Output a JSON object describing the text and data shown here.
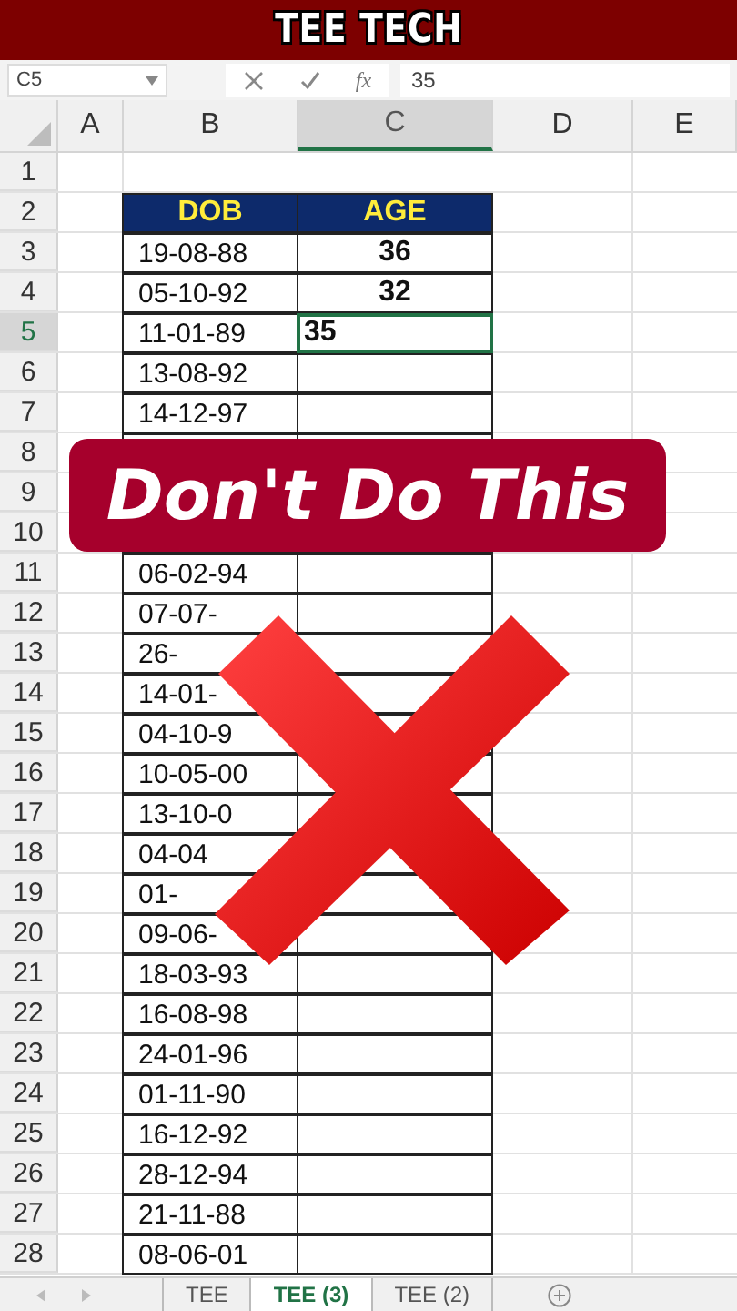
{
  "banner": {
    "title": "TEE TECH"
  },
  "formula_bar": {
    "name_box": "C5",
    "function_label": "fx",
    "value": "35"
  },
  "columns": [
    {
      "label": "A",
      "selected": false
    },
    {
      "label": "B",
      "selected": false
    },
    {
      "label": "C",
      "selected": true
    },
    {
      "label": "D",
      "selected": false
    },
    {
      "label": "E",
      "selected": false
    }
  ],
  "rows": [
    {
      "label": "1",
      "selected": false,
      "kind": "blank"
    },
    {
      "label": "2",
      "selected": false,
      "kind": "header",
      "dob": "DOB",
      "age": "AGE"
    },
    {
      "label": "3",
      "selected": false,
      "kind": "data",
      "dob": "19-08-88",
      "age": "36",
      "age_active": false
    },
    {
      "label": "4",
      "selected": false,
      "kind": "data",
      "dob": "05-10-92",
      "age": "32",
      "age_active": false
    },
    {
      "label": "5",
      "selected": true,
      "kind": "data",
      "dob": "11-01-89",
      "age": "35",
      "age_active": true
    },
    {
      "label": "6",
      "selected": false,
      "kind": "data",
      "dob": "13-08-92",
      "age_active": false
    },
    {
      "label": "7",
      "selected": false,
      "kind": "data",
      "dob": "14-12-97",
      "age_active": false
    },
    {
      "label": "8",
      "selected": false,
      "kind": "data"
    },
    {
      "label": "9",
      "selected": false,
      "kind": "covered"
    },
    {
      "label": "10",
      "selected": false,
      "kind": "data"
    },
    {
      "label": "11",
      "selected": false,
      "kind": "data",
      "dob": "06-02-94",
      "age_active": false
    },
    {
      "label": "12",
      "selected": false,
      "kind": "data",
      "dob": "07-07-",
      "age_active": false
    },
    {
      "label": "13",
      "selected": false,
      "kind": "data",
      "dob": "26-",
      "age_active": false
    },
    {
      "label": "14",
      "selected": false,
      "kind": "data",
      "dob": "14-01-",
      "age_active": false
    },
    {
      "label": "15",
      "selected": false,
      "kind": "data",
      "dob": "04-10-9",
      "age_active": false
    },
    {
      "label": "16",
      "selected": false,
      "kind": "data",
      "dob": "10-05-00",
      "age_active": false
    },
    {
      "label": "17",
      "selected": false,
      "kind": "data",
      "dob": "13-10-0",
      "age_active": false
    },
    {
      "label": "18",
      "selected": false,
      "kind": "data",
      "dob": "04-04",
      "age_active": false
    },
    {
      "label": "19",
      "selected": false,
      "kind": "data",
      "dob": "01-",
      "age_active": false
    },
    {
      "label": "20",
      "selected": false,
      "kind": "data",
      "dob": "09-06-",
      "age_active": false
    },
    {
      "label": "21",
      "selected": false,
      "kind": "data",
      "dob": "18-03-93",
      "age_active": false
    },
    {
      "label": "22",
      "selected": false,
      "kind": "data",
      "dob": "16-08-98",
      "age_active": false
    },
    {
      "label": "23",
      "selected": false,
      "kind": "data",
      "dob": "24-01-96",
      "age_active": false
    },
    {
      "label": "24",
      "selected": false,
      "kind": "data",
      "dob": "01-11-90",
      "age_active": false
    },
    {
      "label": "25",
      "selected": false,
      "kind": "data",
      "dob": "16-12-92",
      "age_active": false
    },
    {
      "label": "26",
      "selected": false,
      "kind": "data",
      "dob": "28-12-94",
      "age_active": false
    },
    {
      "label": "27",
      "selected": false,
      "kind": "data",
      "dob": "21-11-88",
      "age_active": false
    },
    {
      "label": "28",
      "selected": false,
      "kind": "data",
      "dob": "08-06-01",
      "age_active": false
    }
  ],
  "overlay": {
    "caption": "Don't Do This"
  },
  "sheet_tabs": [
    {
      "label": "TEE",
      "selected": false
    },
    {
      "label": "TEE (3)",
      "selected": true
    },
    {
      "label": "TEE (2)",
      "selected": false
    }
  ]
}
